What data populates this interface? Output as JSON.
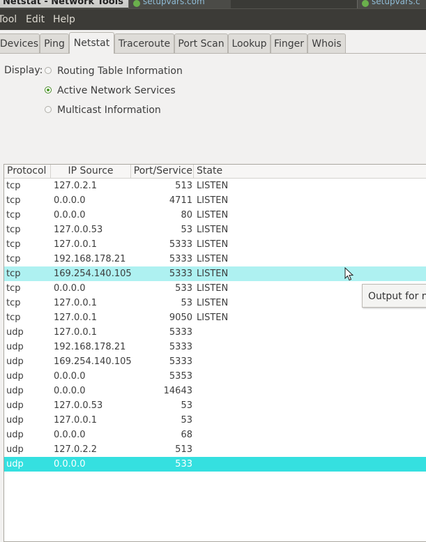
{
  "window": {
    "title": "Netstat - Network Tools",
    "taskbar_tabs": [
      "setupvars.com",
      "setupvars.c"
    ]
  },
  "menubar": {
    "items": [
      "Tool",
      "Edit",
      "Help"
    ]
  },
  "tabs": {
    "items": [
      "Devices",
      "Ping",
      "Netstat",
      "Traceroute",
      "Port Scan",
      "Lookup",
      "Finger",
      "Whois"
    ],
    "active": "Netstat"
  },
  "display": {
    "label": "Display:",
    "options": [
      "Routing Table Information",
      "Active Network Services",
      "Multicast Information"
    ],
    "selected": "Active Network Services"
  },
  "table": {
    "columns": [
      "Protocol",
      "IP Source",
      "Port/Service",
      "State"
    ],
    "rows": [
      [
        "tcp",
        "127.0.2.1",
        "513",
        "LISTEN"
      ],
      [
        "tcp",
        "0.0.0.0",
        "4711",
        "LISTEN"
      ],
      [
        "tcp",
        "0.0.0.0",
        "80",
        "LISTEN"
      ],
      [
        "tcp",
        "127.0.0.53",
        "53",
        "LISTEN"
      ],
      [
        "tcp",
        "127.0.0.1",
        "5333",
        "LISTEN"
      ],
      [
        "tcp",
        "192.168.178.21",
        "5333",
        "LISTEN"
      ],
      [
        "tcp",
        "169.254.140.105",
        "5333",
        "LISTEN"
      ],
      [
        "tcp",
        "0.0.0.0",
        "533",
        "LISTEN"
      ],
      [
        "tcp",
        "127.0.0.1",
        "53",
        "LISTEN"
      ],
      [
        "tcp",
        "127.0.0.1",
        "9050",
        "LISTEN"
      ],
      [
        "udp",
        "127.0.0.1",
        "5333",
        ""
      ],
      [
        "udp",
        "192.168.178.21",
        "5333",
        ""
      ],
      [
        "udp",
        "169.254.140.105",
        "5333",
        ""
      ],
      [
        "udp",
        "0.0.0.0",
        "5353",
        ""
      ],
      [
        "udp",
        "0.0.0.0",
        "14643",
        ""
      ],
      [
        "udp",
        "127.0.0.53",
        "53",
        ""
      ],
      [
        "udp",
        "127.0.0.1",
        "53",
        ""
      ],
      [
        "udp",
        "0.0.0.0",
        "68",
        ""
      ],
      [
        "udp",
        "127.0.2.2",
        "513",
        ""
      ],
      [
        "udp",
        "0.0.0.0",
        "533",
        ""
      ]
    ],
    "hover_row": 6,
    "selected_row": 19
  },
  "tooltip": {
    "text": "Output for ne"
  },
  "colors": {
    "hover": "#aef1f1",
    "selected": "#35e0e0",
    "menubar": "#3c3b37"
  }
}
